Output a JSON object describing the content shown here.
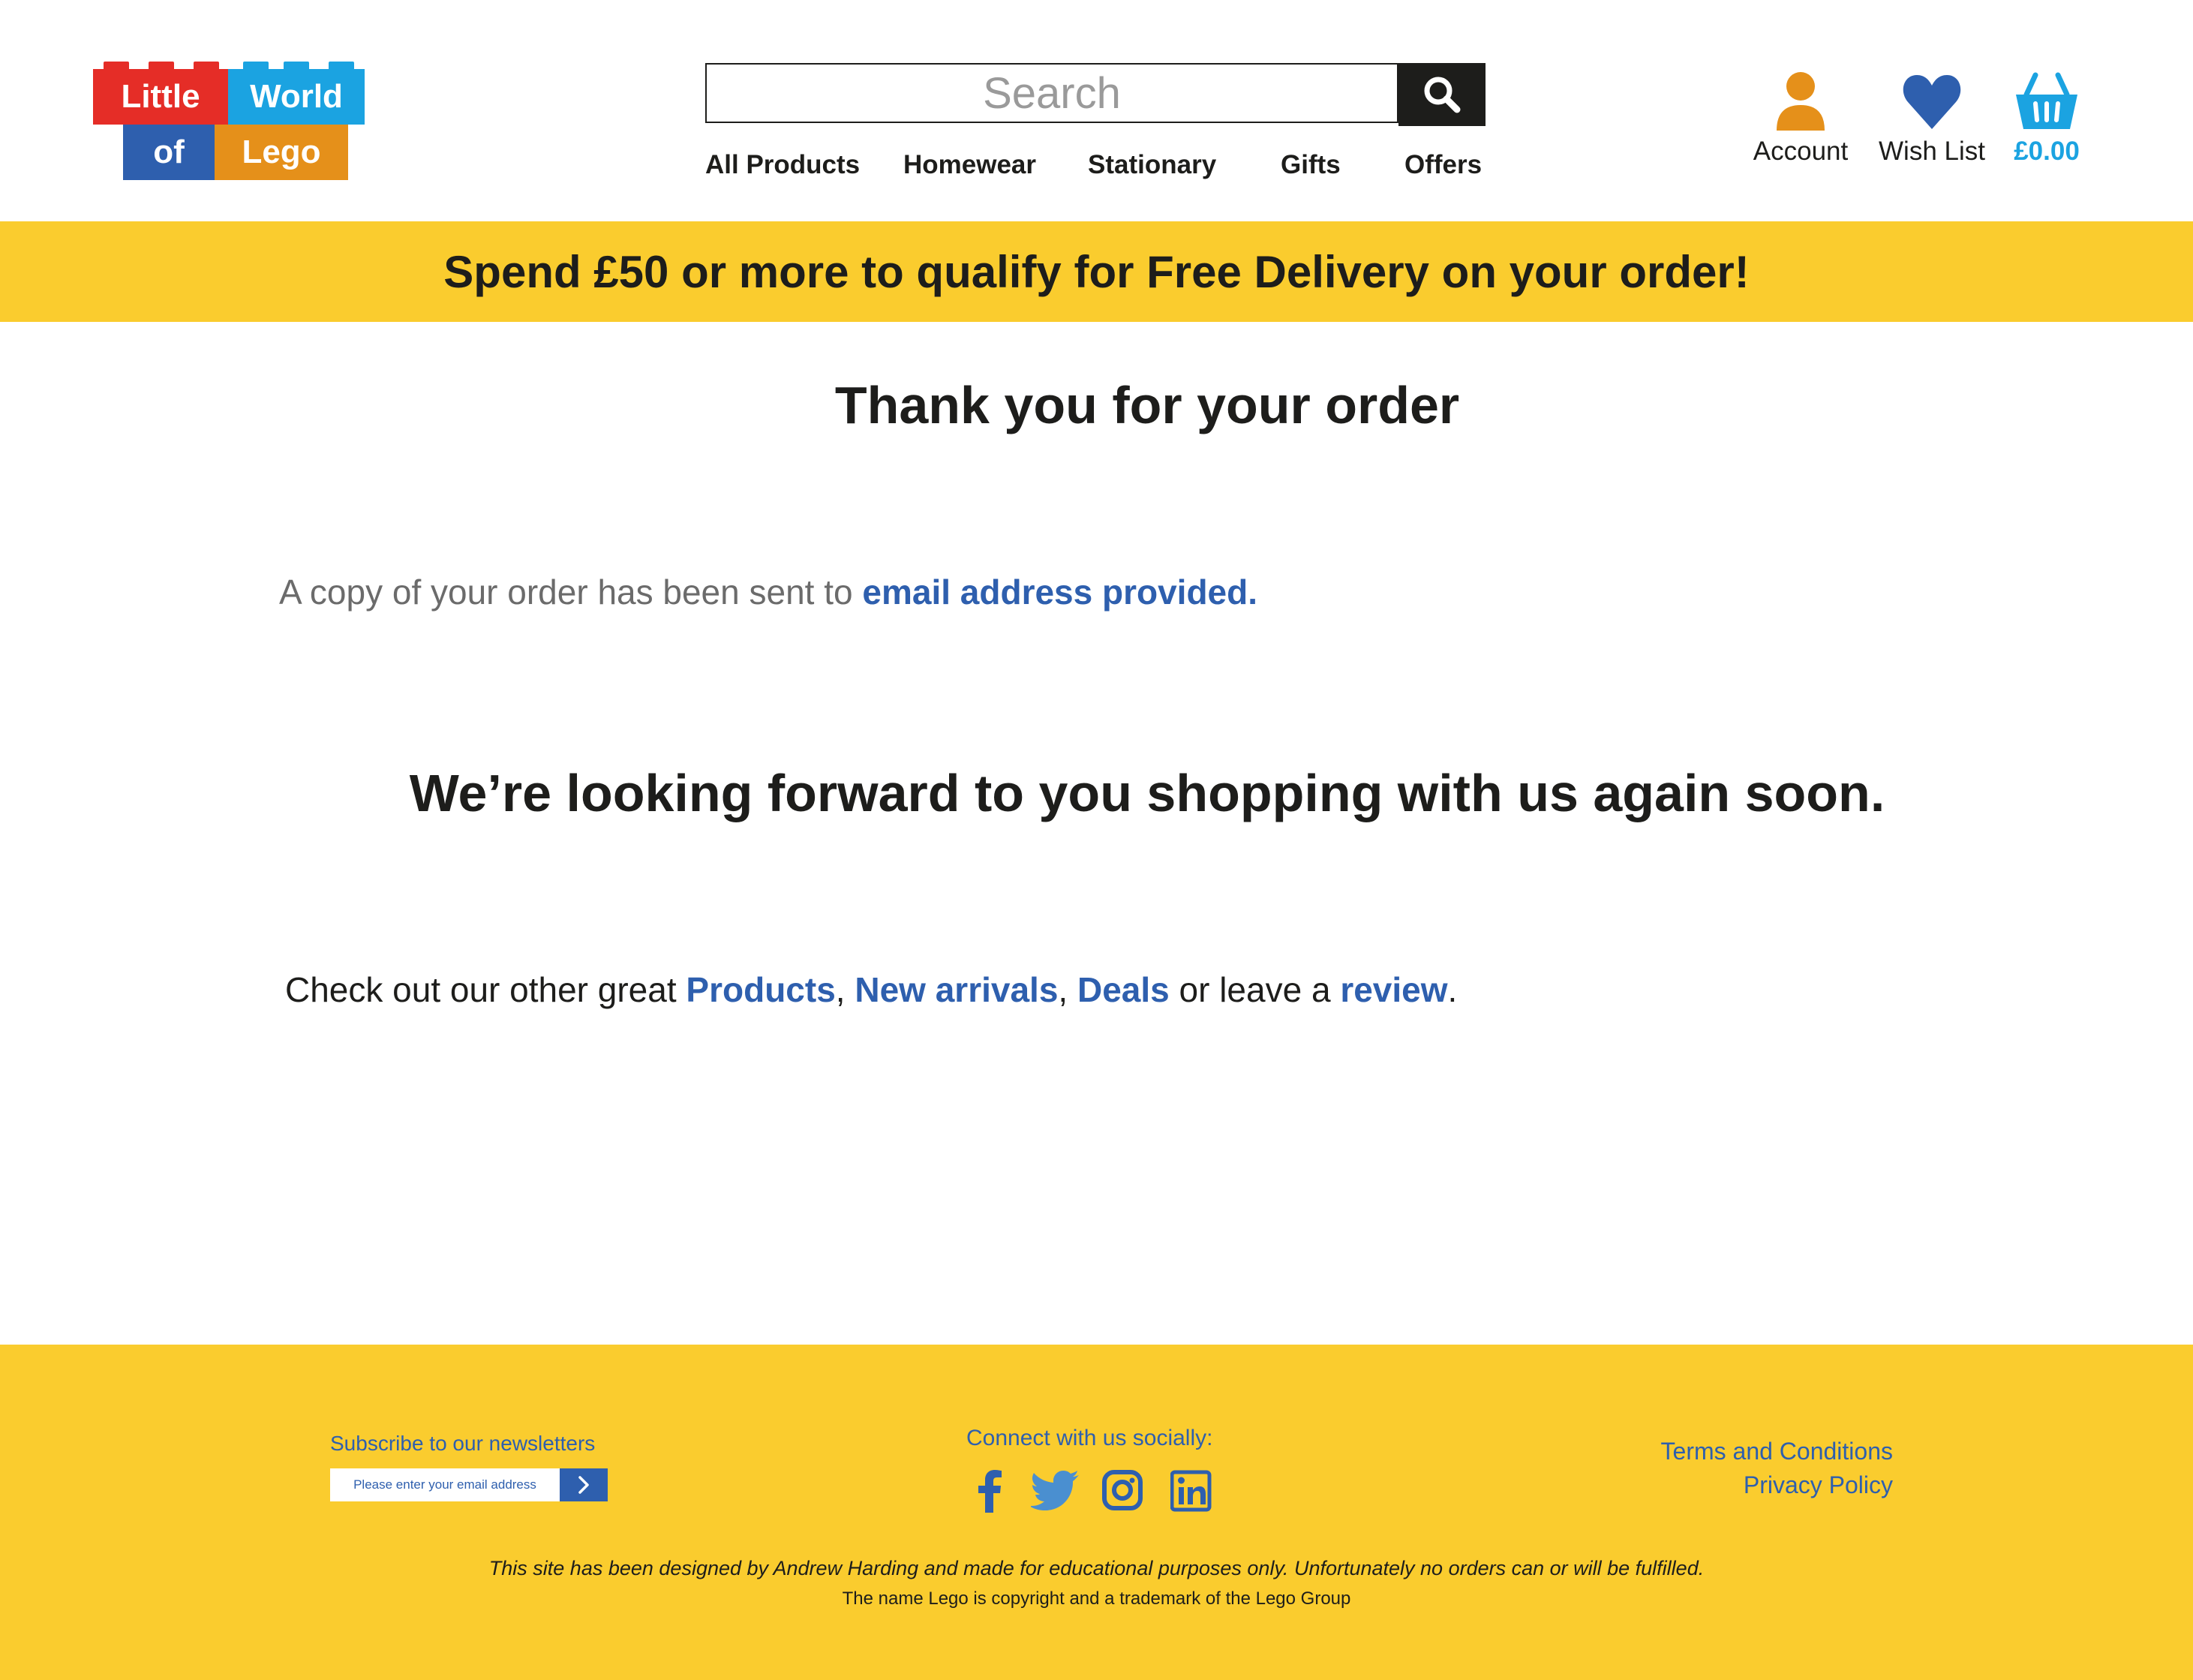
{
  "logo": {
    "word1": "Little",
    "word2": "World",
    "word3": "of",
    "word4": "Lego"
  },
  "search": {
    "placeholder": "Search",
    "button_icon": "magnifier-icon"
  },
  "nav": {
    "items": [
      {
        "label": "All Products"
      },
      {
        "label": "Homewear"
      },
      {
        "label": "Stationary"
      },
      {
        "label": "Gifts"
      },
      {
        "label": "Offers"
      }
    ]
  },
  "utilities": {
    "account_label": "Account",
    "wishlist_label": "Wish List",
    "basket_total": "£0.00"
  },
  "banner": {
    "text": "Spend £50 or more to qualify for Free Delivery on your order!"
  },
  "main": {
    "title": "Thank you for your order",
    "copy_prefix": "A copy of your order has been sent to ",
    "copy_link": "email address provided.",
    "lookforward": "We’re looking forward to you shopping with us again soon.",
    "checkout_prefix": "Check out our other great ",
    "link_products": "Products",
    "sep1": ", ",
    "link_new_arrivals": "New arrivals",
    "sep2": ", ",
    "link_deals": "Deals",
    "middle": " or leave a ",
    "link_review": "review",
    "suffix": "."
  },
  "footer": {
    "newsletter_label": "Subscribe to our newsletters",
    "newsletter_placeholder": "Please enter your email address",
    "social_label": "Connect with us socially:",
    "social_icons": [
      "facebook-icon",
      "twitter-icon",
      "instagram-icon",
      "linkedin-icon"
    ],
    "terms_label": "Terms and Conditions",
    "privacy_label": "Privacy Policy",
    "disclaimer": "This site has been designed by Andrew Harding and made for educational purposes only. Unfortunately no orders can or will be fulfilled.",
    "copyright": "The name Lego is copyright and a trademark of the Lego Group"
  },
  "colors": {
    "brand_yellow": "#facc2e",
    "link_blue": "#2e5fae",
    "account_orange": "#e5901a",
    "basket_cyan": "#1ba3e1",
    "text_dark": "#1d1d1b"
  }
}
